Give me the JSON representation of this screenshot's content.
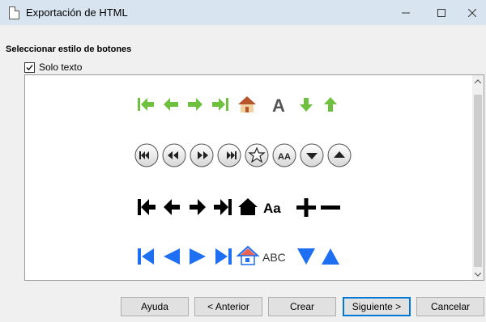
{
  "window": {
    "title": "Exportación de HTML",
    "controls": {
      "minimize": "minimize-icon",
      "maximize": "maximize-icon",
      "close": "close-icon"
    }
  },
  "section": {
    "title": "Seleccionar estilo de botones"
  },
  "option": {
    "label": "Solo texto",
    "checked": true
  },
  "button_styles": [
    {
      "style": "green-arrows",
      "icons": [
        "first-icon",
        "previous-icon",
        "next-icon",
        "last-icon",
        "home-icon",
        "text-icon",
        "down-icon",
        "up-icon"
      ],
      "text_glyph": "A"
    },
    {
      "style": "round-gray",
      "icons": [
        "first-icon",
        "previous-icon",
        "next-icon",
        "last-icon",
        "star-icon",
        "text-icon",
        "down-icon",
        "up-icon"
      ],
      "text_glyph": "AA"
    },
    {
      "style": "black-bold",
      "icons": [
        "first-icon",
        "previous-icon",
        "next-icon",
        "last-icon",
        "home-icon",
        "text-icon",
        "plus-icon",
        "minus-icon"
      ],
      "text_glyph": "Aa"
    },
    {
      "style": "blue-triangles",
      "icons": [
        "first-icon",
        "previous-icon",
        "next-icon",
        "last-icon",
        "home-icon",
        "text-icon",
        "down-icon",
        "up-icon"
      ],
      "text_glyph": "ABC"
    }
  ],
  "colors": {
    "green": "#6ec13f",
    "blue": "#1e6ff2",
    "black": "#000000",
    "home_roof": "#b5562a",
    "default_button_border": "#0078d7"
  },
  "dialog_buttons": {
    "help": "Ayuda",
    "back": "< Anterior",
    "create": "Crear",
    "next": "Siguiente >",
    "cancel": "Cancelar"
  }
}
